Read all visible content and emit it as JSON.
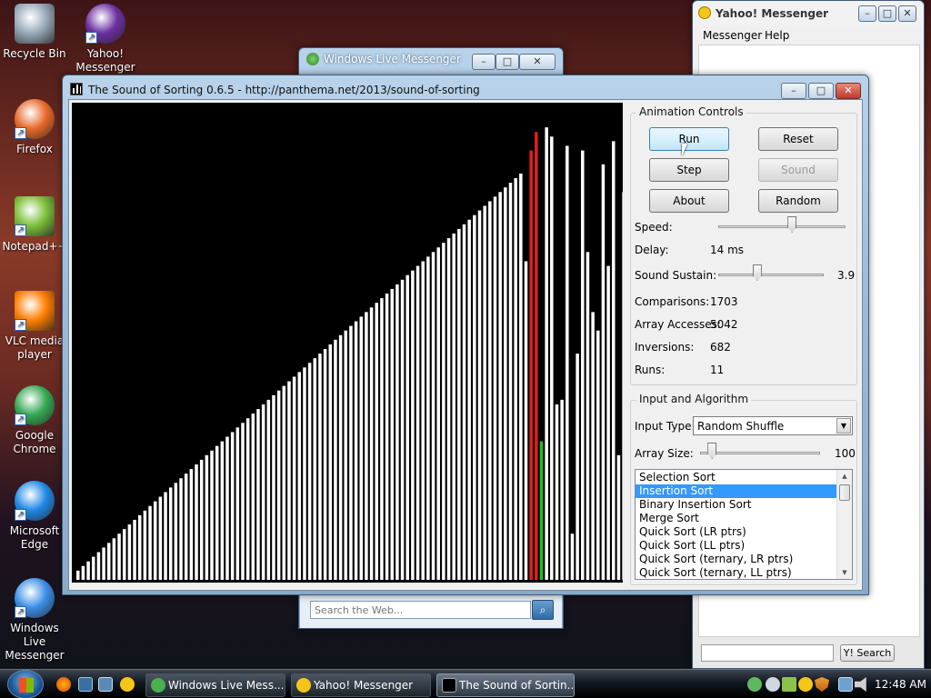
{
  "desktop": {
    "icons": [
      {
        "label": "Recycle Bin",
        "icon": "recycle-bin-icon"
      },
      {
        "label": "Yahoo! Messenger",
        "icon": "yahoo-messenger-icon"
      },
      {
        "label": "Firefox",
        "icon": "firefox-icon"
      },
      {
        "label": "Notepad++",
        "icon": "notepad-plus-plus-icon"
      },
      {
        "label": "VLC media player",
        "icon": "vlc-icon"
      },
      {
        "label": "Google Chrome",
        "icon": "chrome-icon"
      },
      {
        "label": "Microsoft Edge",
        "icon": "edge-icon"
      },
      {
        "label": "Windows Live Messenger",
        "icon": "windows-live-messenger-icon"
      }
    ]
  },
  "wlm_window": {
    "title": "Windows Live Messenger",
    "search_placeholder": "Search the Web..."
  },
  "yahoo_window": {
    "title": "Yahoo! Messenger",
    "menu": [
      "Messenger",
      "Help"
    ],
    "search_button": "Y! Search"
  },
  "sos_window": {
    "title": "The Sound of Sorting 0.6.5 - http://panthema.net/2013/sound-of-sorting",
    "animation_controls": {
      "group_title": "Animation Controls",
      "buttons": {
        "run": "Run",
        "reset": "Reset",
        "step": "Step",
        "sound": "Sound",
        "about": "About",
        "random": "Random"
      },
      "speed_label": "Speed:",
      "delay_label": "Delay:",
      "delay_value": "14 ms",
      "sustain_label": "Sound Sustain:",
      "sustain_value": "3.9",
      "comparisons_label": "Comparisons:",
      "comparisons_value": "1703",
      "accesses_label": "Array Accesses:",
      "accesses_value": "5042",
      "inversions_label": "Inversions:",
      "inversions_value": "682",
      "runs_label": "Runs:",
      "runs_value": "11",
      "speed_level": 0.58,
      "sustain_level": 0.37
    },
    "input_algorithm": {
      "group_title": "Input and Algorithm",
      "input_type_label": "Input Type:",
      "input_type_value": "Random Shuffle",
      "array_size_label": "Array Size:",
      "array_size_value": "100",
      "array_size_level": 0.1,
      "algorithms": [
        "Selection Sort",
        "Insertion Sort",
        "Binary Insertion Sort",
        "Merge Sort",
        "Quick Sort (LR ptrs)",
        "Quick Sort (LL ptrs)",
        "Quick Sort (ternary, LR ptrs)",
        "Quick Sort (ternary, LL ptrs)"
      ],
      "selected_index": 1
    }
  },
  "taskbar": {
    "tasks": [
      "Windows Live Mess...",
      "Yahoo! Messenger",
      "The Sound of Sortin..."
    ],
    "clock": "12:48 AM"
  },
  "colors": {
    "bar": "#ffffff",
    "compare": "#e02020",
    "access": "#20c020",
    "canvas": "#000000",
    "selection": "#3399ff"
  },
  "chart_data": {
    "type": "bar",
    "values": [
      2,
      3,
      4,
      5,
      6,
      7,
      8,
      9,
      10,
      11,
      12,
      13,
      14,
      15,
      16,
      17,
      18,
      19,
      20,
      21,
      22,
      23,
      24,
      25,
      26,
      27,
      28,
      29,
      30,
      31,
      32,
      33,
      34,
      35,
      36,
      37,
      38,
      39,
      40,
      41,
      42,
      43,
      44,
      45,
      46,
      47,
      48,
      49,
      50,
      51,
      52,
      53,
      54,
      55,
      56,
      57,
      58,
      59,
      60,
      61,
      62,
      63,
      64,
      65,
      66,
      67,
      68,
      69,
      70,
      71,
      72,
      73,
      74,
      75,
      76,
      77,
      78,
      79,
      80,
      81,
      82,
      83,
      84,
      85,
      86,
      87,
      88,
      69,
      93,
      97,
      30,
      98,
      96,
      38,
      39,
      94,
      10,
      49,
      93,
      71,
      58,
      54,
      90,
      68,
      95,
      27,
      84
    ],
    "highlight_red": [
      88,
      89
    ],
    "highlight_green": [
      90
    ],
    "ylim": [
      0,
      100
    ]
  }
}
